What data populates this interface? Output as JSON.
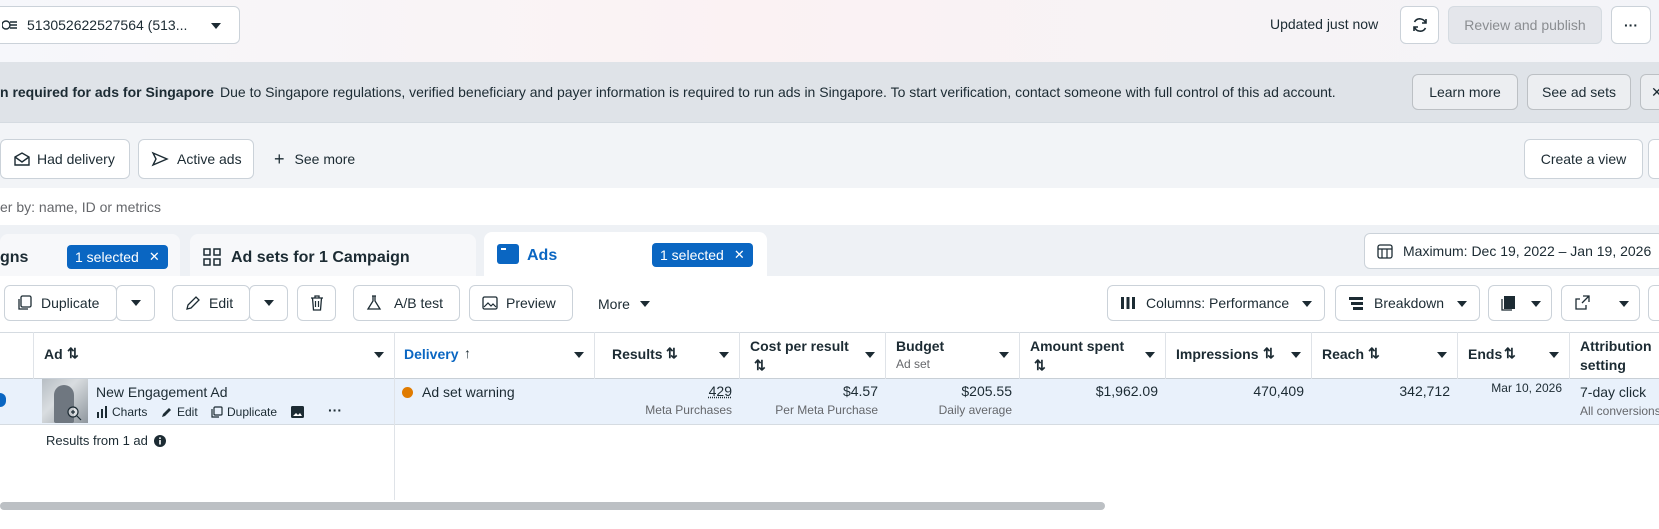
{
  "top": {
    "account_selector": "513052622527564 (513...",
    "updated_text": "Updated just now",
    "review_publish": "Review and publish",
    "more": "···"
  },
  "banner": {
    "title": "n required for ads for Singapore",
    "message": "Due to Singapore regulations, verified beneficiary and payer information is required to run ads in Singapore. To start verification, contact someone with full control of this ad account.",
    "learn_more": "Learn more",
    "see_ad_sets": "See ad sets"
  },
  "views": {
    "had_delivery": "Had delivery",
    "active_ads": "Active ads",
    "see_more": "See more",
    "create_view": "Create a view"
  },
  "filter": {
    "placeholder": "er by: name, ID or metrics"
  },
  "tabs": {
    "campaigns": "gns",
    "campaigns_selected": "1 selected",
    "adsets": "Ad sets for 1 Campaign",
    "ads": "Ads",
    "ads_selected": "1 selected",
    "date_range": "Maximum: Dec 19, 2022 – Jan 19, 2026"
  },
  "toolbar": {
    "duplicate": "Duplicate",
    "edit": "Edit",
    "ab_test": "A/B test",
    "preview": "Preview",
    "more": "More",
    "columns": "Columns: Performance",
    "breakdown": "Breakdown"
  },
  "columns": {
    "ad": "Ad",
    "delivery": "Delivery",
    "results": "Results",
    "cost_per_result": "Cost per result",
    "budget": "Budget",
    "budget_sub": "Ad set",
    "amount_spent": "Amount spent",
    "impressions": "Impressions",
    "reach": "Reach",
    "ends": "Ends",
    "attribution_1": "Attribution",
    "attribution_2": "setting"
  },
  "row": {
    "name": "New Engagement Ad",
    "charts": "Charts",
    "edit": "Edit",
    "duplicate": "Duplicate",
    "delivery": "Ad set warning",
    "results": "429",
    "results_sub": "Meta Purchases",
    "cost": "$4.57",
    "cost_sub": "Per Meta Purchase",
    "budget": "$205.55",
    "budget_sub": "Daily average",
    "spent": "$1,962.09",
    "impressions": "470,409",
    "reach": "342,712",
    "ends": "Mar 10, 2026",
    "attribution": "7-day click",
    "attribution_sub": "All conversions"
  },
  "footer": {
    "results_text": "Results from 1 ad"
  },
  "colors": {
    "accent": "#0a66c2",
    "warning": "#e07b00",
    "row_highlight": "#e9f1fb"
  }
}
